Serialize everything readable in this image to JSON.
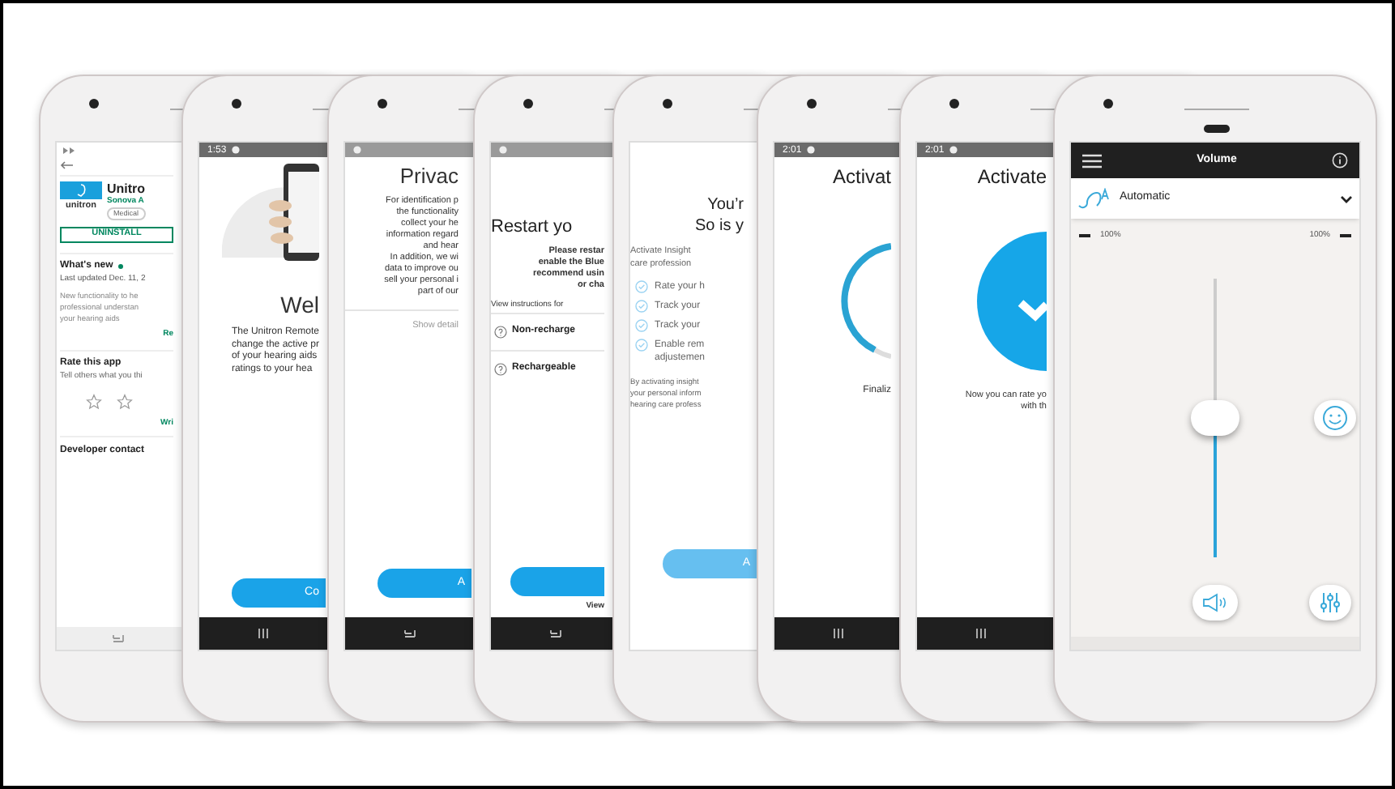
{
  "phones": [
    {
      "kind": "store",
      "app_title": "Unitro",
      "developer": "Sonova A",
      "category": "Medical",
      "logo_text": "unitron",
      "button": "UNINSTALL",
      "whats_new": "What's new",
      "updated": "Last updated Dec. 11, 2",
      "lines": [
        "New functionality to he",
        "professional understan",
        "your hearing aids"
      ],
      "more_link": "Re",
      "rate_title": "Rate this app",
      "rate_subtitle": "Tell others what you thi",
      "review_link": "Wri",
      "contact": "Developer contact"
    },
    {
      "kind": "welcome",
      "time": "1:53",
      "title": "Wel",
      "lines": [
        "The Unitron Remote",
        "change the active pr",
        "of your hearing aids",
        "ratings to your hea"
      ],
      "button": "Co"
    },
    {
      "kind": "privacy",
      "title": "Privac",
      "lines": [
        "For identification p",
        "the functionality",
        "collect your he",
        "information regard",
        "and hear",
        "In addition, we wi",
        "data to improve ou",
        "sell your personal i",
        "part of our"
      ],
      "details": "Show detail",
      "button": "A"
    },
    {
      "kind": "restart",
      "title": "Restart yo",
      "lines": [
        "Please restar",
        "enable the Blue",
        "recommend usin",
        "or cha"
      ],
      "instructions": "View instructions for",
      "options": [
        "Non-recharge",
        "Rechargeable"
      ],
      "link": "View"
    },
    {
      "kind": "insights",
      "title_lines": [
        "You’r",
        "So is y"
      ],
      "intro": [
        "Activate Insight",
        "care profession"
      ],
      "checks": [
        [
          "Rate your h"
        ],
        [
          "Track your"
        ],
        [
          "Track your"
        ],
        [
          "Enable rem",
          "adjustemen"
        ]
      ],
      "footer": [
        "By activating insight",
        "your personal inform",
        "hearing care profess"
      ],
      "button": "A"
    },
    {
      "kind": "progress",
      "time": "2:01",
      "title": "Activat",
      "caption": "Finaliz"
    },
    {
      "kind": "done",
      "time": "2:01",
      "title": "Activate",
      "lines": [
        "Now you can rate yo",
        "with th"
      ]
    },
    {
      "kind": "volume",
      "title": "Volume",
      "program": "Automatic",
      "left_reading": "100%",
      "right_reading": "100%",
      "level": 0.5
    }
  ]
}
